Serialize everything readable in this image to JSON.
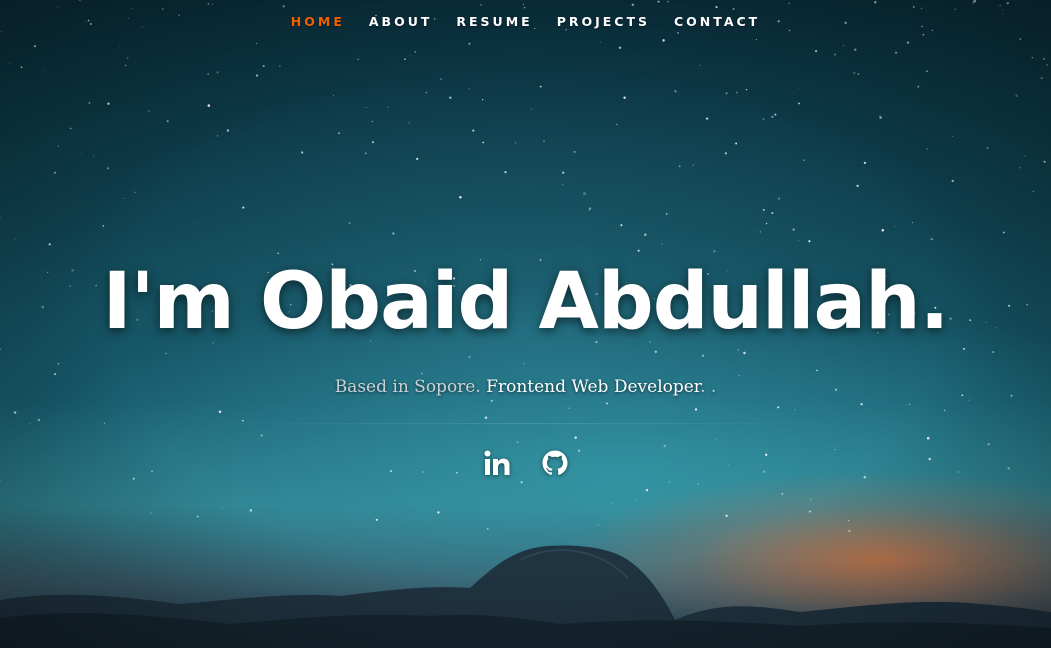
{
  "nav": {
    "items": [
      {
        "label": "HOME",
        "active": true
      },
      {
        "label": "ABOUT",
        "active": false
      },
      {
        "label": "RESUME",
        "active": false
      },
      {
        "label": "PROJECTS",
        "active": false
      },
      {
        "label": "CONTACT",
        "active": false
      }
    ]
  },
  "hero": {
    "headline": "I'm Obaid Abdullah.",
    "location": "Based in Sopore.",
    "role": "Frontend Web Developer",
    "role_suffix": ". ."
  },
  "social": [
    {
      "icon": "linkedin-icon"
    },
    {
      "icon": "github-icon"
    }
  ],
  "colors": {
    "accent": "#f06000",
    "text": "#ffffff"
  }
}
